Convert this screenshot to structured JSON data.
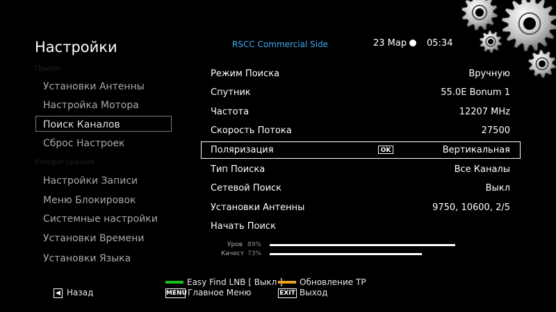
{
  "header": {
    "title": "Настройки",
    "channel": "RSCC Commercial Side",
    "date": "23 Мар",
    "time": "05:34"
  },
  "sidebar": {
    "categories": [
      "Прием",
      "Конфигурация"
    ],
    "items": [
      {
        "label": "Установки Антенны"
      },
      {
        "label": "Настройка Мотора"
      },
      {
        "label": "Поиск Каналов"
      },
      {
        "label": "Сброс Настроек"
      },
      {
        "label": "Настройки Записи"
      },
      {
        "label": "Меню Блокировок"
      },
      {
        "label": "Системные настройки"
      },
      {
        "label": "Установки Времени"
      },
      {
        "label": "Установки Языка"
      }
    ],
    "selected_index": 2
  },
  "settings": [
    {
      "label": "Режим Поиска",
      "value": "Вручную"
    },
    {
      "label": "Спутник",
      "value": "55.0E Bonum 1"
    },
    {
      "label": "Частота",
      "value": "12207 MHz"
    },
    {
      "label": "Скорость Потока",
      "value": "27500"
    },
    {
      "label": "Поляризация",
      "value": "Вертикальная"
    },
    {
      "label": "Тип Поиска",
      "value": "Все Каналы"
    },
    {
      "label": "Сетевой Поиск",
      "value": "Выкл"
    },
    {
      "label": "Установки Антенны",
      "value": "9750, 10600, 2/5"
    },
    {
      "label": "Начать Поиск",
      "value": ""
    }
  ],
  "selected_setting_index": 4,
  "ok_badge": "OK",
  "signal": {
    "level": {
      "label": "Уров",
      "percent_text": "89%",
      "value": 89
    },
    "quality": {
      "label": "Качест",
      "percent_text": "73%",
      "value": 73
    }
  },
  "footer": {
    "back_key_icon": "left-arrow-icon",
    "back_label": "Назад",
    "menu_key": "MENU",
    "menu_label": "Главное Меню",
    "exit_key": "EXIT",
    "exit_label": "Выход",
    "green_label": "Easy Find LNB [ Выкл ]",
    "yellow_label": "Обновление TP",
    "green_color": "#18c418",
    "yellow_color": "#f0a020"
  }
}
